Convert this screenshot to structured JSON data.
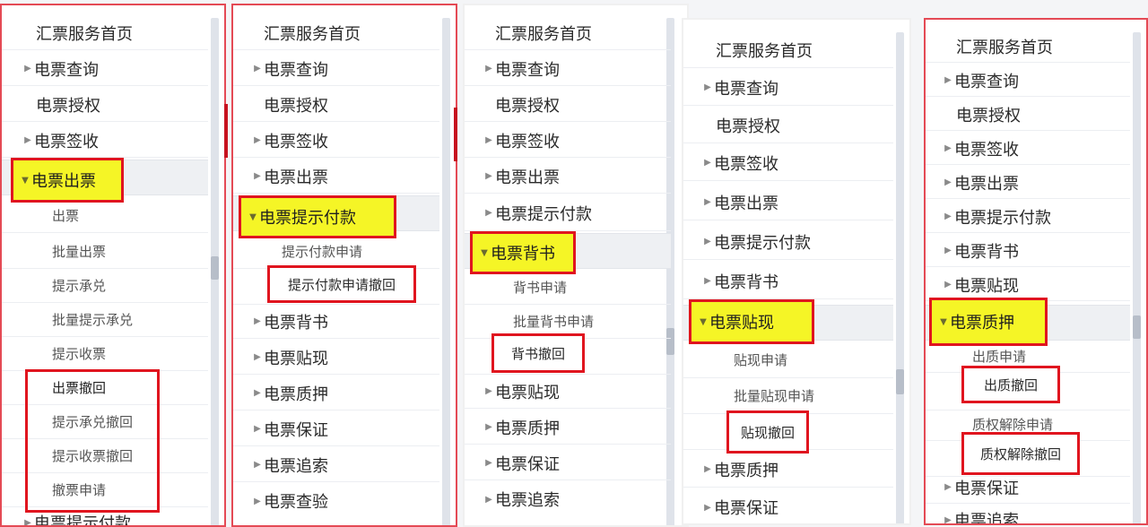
{
  "colors": {
    "highlight_fill": "#f5f526",
    "highlight_border": "#e0151f",
    "panel_border": "#e44a55"
  },
  "p1": {
    "home": "汇票服务首页",
    "query": "电票查询",
    "auth": "电票授权",
    "sign": "电票签收",
    "issue": "电票出票",
    "sub": [
      "出票",
      "批量出票",
      "提示承兑",
      "批量提示承兑",
      "提示收票"
    ],
    "boxed": [
      "出票撤回",
      "提示承兑撤回",
      "提示收票撤回",
      "撤票申请"
    ],
    "bottom": "电票提示付款"
  },
  "p2": {
    "home": "汇票服务首页",
    "query": "电票查询",
    "auth": "电票授权",
    "sign": "电票签收",
    "issue": "电票出票",
    "pay": "电票提示付款",
    "sub1": "提示付款申请",
    "sub2": "提示付款申请撤回",
    "endorse": "电票背书",
    "discount": "电票贴现",
    "pledge": "电票质押",
    "guarantee": "电票保证",
    "recourse": "电票追索",
    "check": "电票查验"
  },
  "p3": {
    "home": "汇票服务首页",
    "query": "电票查询",
    "auth": "电票授权",
    "sign": "电票签收",
    "issue": "电票出票",
    "pay": "电票提示付款",
    "endorse": "电票背书",
    "sub1": "背书申请",
    "sub2": "批量背书申请",
    "sub3": "背书撤回",
    "discount": "电票贴现",
    "pledge": "电票质押",
    "guarantee": "电票保证",
    "recourse": "电票追索"
  },
  "p4": {
    "home": "汇票服务首页",
    "query": "电票查询",
    "auth": "电票授权",
    "sign": "电票签收",
    "issue": "电票出票",
    "pay": "电票提示付款",
    "endorse": "电票背书",
    "discount": "电票贴现",
    "sub1": "贴现申请",
    "sub2": "批量贴现申请",
    "sub3": "贴现撤回",
    "pledge": "电票质押",
    "guarantee": "电票保证"
  },
  "p5": {
    "home": "汇票服务首页",
    "query": "电票查询",
    "auth": "电票授权",
    "sign": "电票签收",
    "issue": "电票出票",
    "pay": "电票提示付款",
    "endorse": "电票背书",
    "discount": "电票贴现",
    "pledge": "电票质押",
    "sub1": "出质申请",
    "sub2": "出质撤回",
    "sub3": "质权解除申请",
    "sub4": "质权解除撤回",
    "guarantee": "电票保证",
    "recourse": "电票追索"
  }
}
